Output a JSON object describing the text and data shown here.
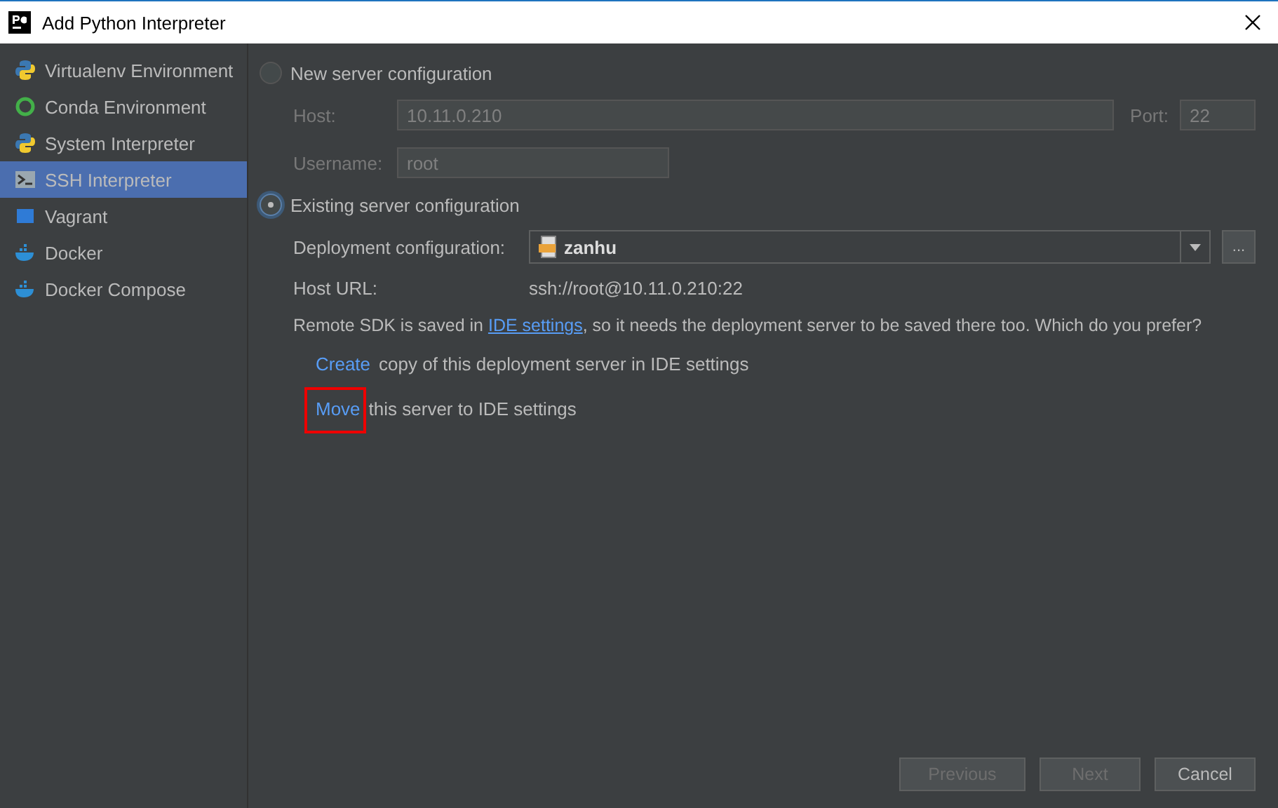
{
  "window": {
    "title": "Add Python Interpreter"
  },
  "interpreter_types": [
    {
      "label": "Virtualenv Environment",
      "kind": "python",
      "selected": false
    },
    {
      "label": "Conda Environment",
      "kind": "conda",
      "selected": false
    },
    {
      "label": "System Interpreter",
      "kind": "python",
      "selected": false
    },
    {
      "label": "SSH Interpreter",
      "kind": "terminal",
      "selected": true
    },
    {
      "label": "Vagrant",
      "kind": "vagrant",
      "selected": false
    },
    {
      "label": "Docker",
      "kind": "docker",
      "selected": false
    },
    {
      "label": "Docker Compose",
      "kind": "docker",
      "selected": false
    }
  ],
  "new_server": {
    "label": "New server configuration",
    "selected": false,
    "host_label": "Host:",
    "host_value": "10.11.0.210",
    "port_label": "Port:",
    "port_value": "22",
    "username_label": "Username:",
    "username_value": "root"
  },
  "existing_server": {
    "label": "Existing server configuration",
    "selected": true,
    "deployment_label": "Deployment configuration:",
    "deployment_value": "zanhu",
    "more_button": "...",
    "host_url_label": "Host URL:",
    "host_url_value": "ssh://root@10.11.0.210:22"
  },
  "notice": {
    "before": "Remote SDK is saved in",
    "link": "IDE settings",
    "after": ", so it needs the deployment server to be saved there too. Which do you prefer?"
  },
  "choices": [
    {
      "link": "Create",
      "text": "copy of this deployment server in IDE settings",
      "highlighted": false
    },
    {
      "link": "Move",
      "text": "this server to IDE settings",
      "highlighted": true
    }
  ],
  "buttons": [
    {
      "label": "Previous",
      "disabled": true
    },
    {
      "label": "Next",
      "disabled": true
    },
    {
      "label": "Cancel",
      "disabled": false
    }
  ]
}
